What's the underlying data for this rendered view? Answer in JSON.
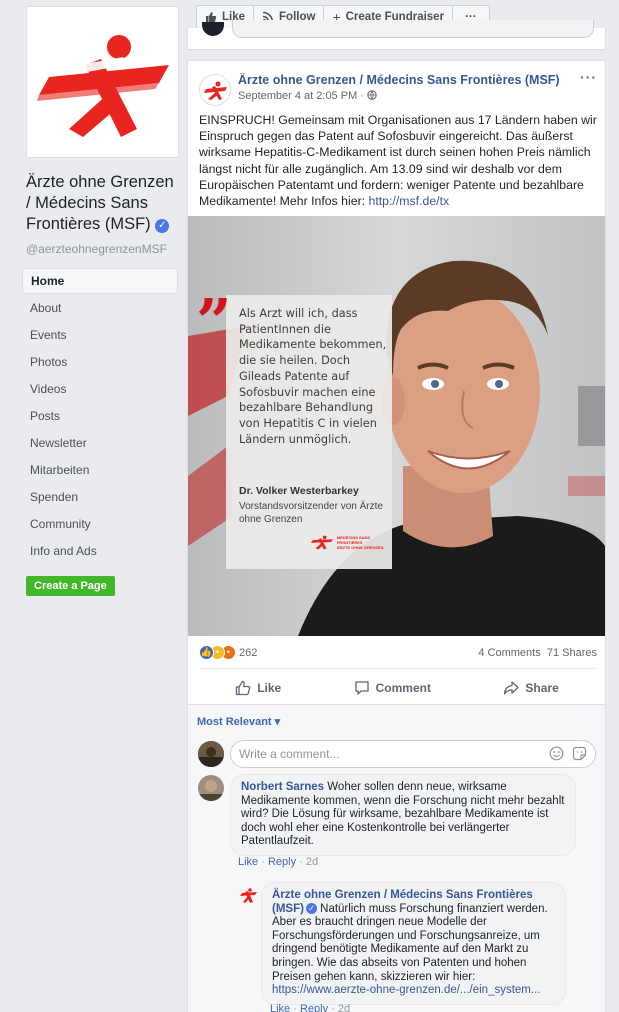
{
  "page": {
    "name": "Ärzte ohne Grenzen / Médecins Sans Frontières (MSF)",
    "verified_mark": "✓",
    "handle": "@aerzteohnegrenzenMSF",
    "create_page_label": "Create a Page"
  },
  "nav": {
    "items": [
      {
        "label": "Home",
        "active": true
      },
      {
        "label": "About"
      },
      {
        "label": "Events"
      },
      {
        "label": "Photos"
      },
      {
        "label": "Videos"
      },
      {
        "label": "Posts"
      },
      {
        "label": "Newsletter"
      },
      {
        "label": "Mitarbeiten"
      },
      {
        "label": "Spenden"
      },
      {
        "label": "Community"
      },
      {
        "label": "Info and Ads"
      }
    ]
  },
  "actionbar": {
    "like": "Like",
    "follow": "Follow",
    "fundraiser": "Create Fundraiser",
    "more": "···"
  },
  "post": {
    "author": "Ärzte ohne Grenzen / Médecins Sans Frontières (MSF)",
    "timestamp": "September 4 at 2:05 PM ·",
    "more": "···",
    "text": "EINSPRUCH! Gemeinsam mit Organisationen aus 17 Ländern haben wir Einspruch gegen das Patent auf Sofosbuvir eingereicht. Das äußerst wirksame Hepatitis-C-Medikament ist durch seinen hohen Preis nämlich längst nicht für alle zugänglich. Am 13.09 sind wir deshalb vor dem Europäischen Patentamt und fordern: weniger Patente und bezahlbare Medikamente! Mehr Infos hier: ",
    "link": "http://msf.de/tx",
    "image": {
      "quote": "Als Arzt will ich, dass PatientInnen die Medikamente bekommen, die sie heilen. Doch Gileads Patente auf Sofosbuvir machen eine bezahlbare Behandlung von Hepatitis C in vielen Ländern unmöglich.",
      "quote_author": "Dr. Volker Westerbarkey",
      "quote_role": "Vorstandsvorsitzender von Ärzte ohne Grenzen",
      "logo_text_1": "MÉDECINS SANS FRONTIÈRES",
      "logo_text_2": "ÄRZTE OHNE GRENZEN"
    },
    "reactions_count": "262",
    "comments_count": "4 Comments",
    "shares_count": "71 Shares",
    "actions": {
      "like": "Like",
      "comment": "Comment",
      "share": "Share"
    }
  },
  "comments": {
    "sort_label": "Most Relevant ▾",
    "input_placeholder": "Write a comment...",
    "items": [
      {
        "author": "Norbert Sarnes",
        "text": " Woher sollen denn neue, wirksame Medikamente kommen, wenn die Forschung nicht mehr bezahlt wird? Die Lösung für wirksame, bezahlbare Medikamente ist doch wohl eher eine Kostenkontrolle bei verlängerter Patentlaufzeit.",
        "like": "Like",
        "reply": "Reply",
        "time": "2d"
      },
      {
        "author": "Ärzte ohne Grenzen / Médecins Sans Frontières (MSF)",
        "text": " Natürlich muss Forschung finanziert werden. Aber es braucht dringen neue Modelle der Forschungsförderungen und Forschungsanreize, um dringend benötigte Medikamente auf den Markt zu bringen. Wie das abseits von Patenten und hohen Preisen gehen kann, skizzieren wir hier: ",
        "link": "https://www.aerzte-ohne-grenzen.de/.../ein_system...",
        "like": "Like",
        "reply": "Reply",
        "time": "2d"
      }
    ]
  },
  "colors": {
    "msf_red": "#e8251f",
    "link_blue": "#365899",
    "green": "#42b72a"
  }
}
